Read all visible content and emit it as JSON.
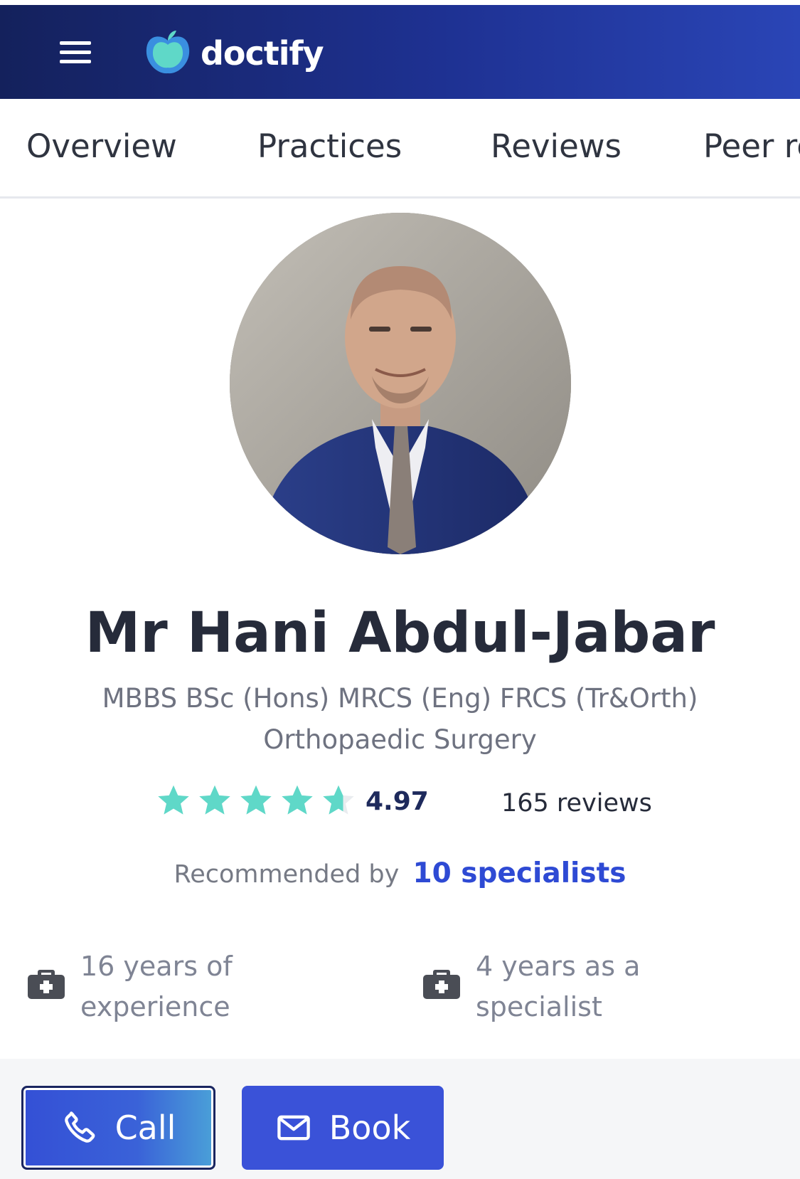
{
  "header": {
    "brand_name": "doctify",
    "menu_icon": "hamburger-menu-icon",
    "colors": {
      "bar_start": "#14215c",
      "bar_end": "#2a45b6",
      "logo_teal": "#5fd8c8",
      "logo_blue": "#3a8fe0"
    }
  },
  "tabs": [
    {
      "label": "Overview"
    },
    {
      "label": "Practices"
    },
    {
      "label": "Reviews"
    },
    {
      "label": "Peer re"
    }
  ],
  "profile": {
    "photo_icon": "doctor-portrait",
    "name": "Mr Hani Abdul-Jabar",
    "qualifications": "MBBS BSc (Hons) MRCS (Eng) FRCS (Tr&Orth)",
    "specialty": "Orthopaedic Surgery",
    "rating_value": "4.97",
    "rating_stars": 4.97,
    "star_color": "#5fd8c8",
    "reviews_count": "165 reviews",
    "recommended_label": "Recommended by",
    "recommended_link": "10 specialists",
    "link_color": "#2e4ad4"
  },
  "stats": [
    {
      "icon": "medical-briefcase-icon",
      "line1": "16 years of",
      "line2": "experience"
    },
    {
      "icon": "medical-briefcase-icon",
      "line1": "4 years as a",
      "line2": "specialist"
    }
  ],
  "actions": {
    "call_label": "Call",
    "call_icon": "phone-icon",
    "book_label": "Book",
    "book_icon": "mail-icon",
    "button_color": "#3a52d8"
  }
}
